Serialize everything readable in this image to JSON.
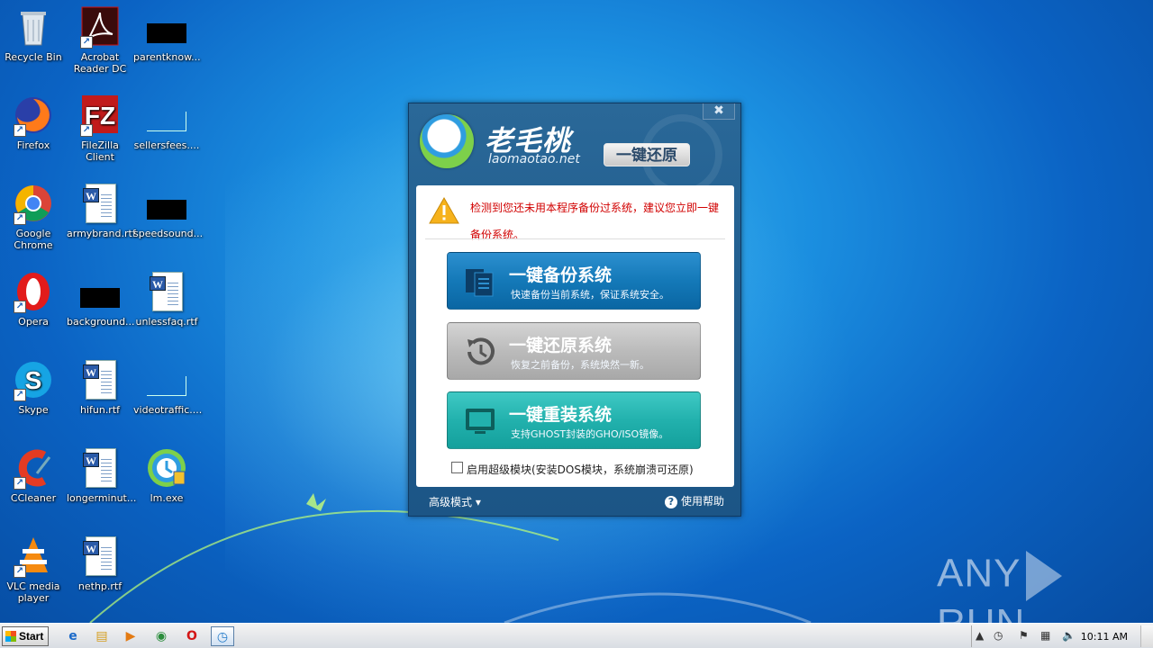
{
  "desktop": {
    "icons": [
      {
        "label": "Recycle Bin",
        "icon": "recycle-bin-icon"
      },
      {
        "label": "Acrobat Reader DC",
        "icon": "acrobat-icon"
      },
      {
        "label": "parentknow...",
        "icon": "black-file-icon"
      },
      {
        "label": "Firefox",
        "icon": "firefox-icon"
      },
      {
        "label": "FileZilla Client",
        "icon": "filezilla-icon"
      },
      {
        "label": "sellersfees....",
        "icon": "blank-file-icon"
      },
      {
        "label": "Google Chrome",
        "icon": "chrome-icon"
      },
      {
        "label": "armybrand.rtf",
        "icon": "word-doc-icon"
      },
      {
        "label": "speedsound...",
        "icon": "black-file-icon"
      },
      {
        "label": "Opera",
        "icon": "opera-icon"
      },
      {
        "label": "background...",
        "icon": "black-file-icon"
      },
      {
        "label": "unlessfaq.rtf",
        "icon": "word-doc-icon"
      },
      {
        "label": "Skype",
        "icon": "skype-icon"
      },
      {
        "label": "hifun.rtf",
        "icon": "word-doc-icon"
      },
      {
        "label": "videotraffic....",
        "icon": "blank-file-icon"
      },
      {
        "label": "CCleaner",
        "icon": "ccleaner-icon"
      },
      {
        "label": "longerminut...",
        "icon": "word-doc-icon"
      },
      {
        "label": "lm.exe",
        "icon": "laomaotao-exe-icon"
      },
      {
        "label": "VLC media player",
        "icon": "vlc-icon"
      },
      {
        "label": "nethp.rtf",
        "icon": "word-doc-icon"
      }
    ]
  },
  "dialog": {
    "close_label": "✖",
    "logo_title": "老毛桃",
    "logo_url": "laomaotao.net",
    "logo_tag": "一键还原",
    "warning_text": "检测到您还未用本程序备份过系统，建议您立即一键备份系统。",
    "buttons": {
      "backup": {
        "title": "一键备份系统",
        "subtitle": "快速备份当前系统，保证系统安全。"
      },
      "restore": {
        "title": "一键还原系统",
        "subtitle": "恢复之前备份，系统焕然一新。"
      },
      "reinstall": {
        "title": "一键重装系统",
        "subtitle": "支持GHOST封装的GHO/ISO镜像。"
      }
    },
    "checkbox_label": "启用超级模块(安装DOS模块，系统崩溃可还原)",
    "advanced_label": "高级模式 ▾",
    "help_label": "使用帮助",
    "help_glyph": "?"
  },
  "watermark": {
    "left": "ANY",
    "right": "RUN"
  },
  "taskbar": {
    "start_label": "Start",
    "clock": "10:11 AM",
    "pinned": [
      {
        "name": "ie-icon",
        "glyph": "e"
      },
      {
        "name": "explorer-icon",
        "glyph": "▤"
      },
      {
        "name": "media-player-icon",
        "glyph": "▶"
      },
      {
        "name": "chrome-icon",
        "glyph": "◉"
      },
      {
        "name": "opera-icon",
        "glyph": "O"
      },
      {
        "name": "laomaotao-task-icon",
        "glyph": "◷"
      }
    ],
    "tray": [
      {
        "name": "tray-expand-icon",
        "glyph": "▲"
      },
      {
        "name": "laomaotao-tray-icon",
        "glyph": "◷"
      },
      {
        "name": "flag-icon",
        "glyph": "⚑"
      },
      {
        "name": "network-icon",
        "glyph": "▦"
      },
      {
        "name": "volume-icon",
        "glyph": "🔈"
      }
    ]
  }
}
